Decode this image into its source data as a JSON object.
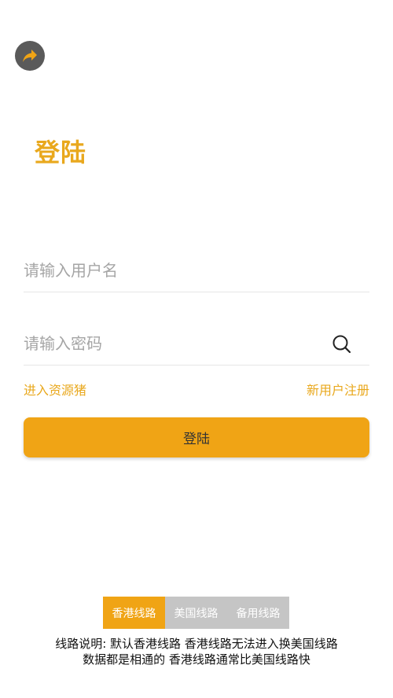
{
  "header": {
    "share_icon": "share-arrow-icon",
    "title": "登陆"
  },
  "form": {
    "username_placeholder": "请输入用户名",
    "password_placeholder": "请输入密码",
    "reveal_icon": "search-icon",
    "enter_link": "进入资源猪",
    "register_link": "新用户注册",
    "login_label": "登陆"
  },
  "lines": {
    "selected": "香港线路",
    "tabs": [
      {
        "label": "香港线路",
        "active": true
      },
      {
        "label": "美国线路",
        "active": false
      },
      {
        "label": "备用线路",
        "active": false
      }
    ]
  },
  "notes": {
    "line1": "线路说明: 默认香港线路 香港线路无法进入换美国线路",
    "line2": "数据都是相通的 香港线路通常比美国线路快"
  },
  "colors": {
    "accent": "#f0a415",
    "title": "#e9a81d",
    "tab_inactive": "#c5c5c5",
    "share_bg": "#5a5a5a"
  }
}
